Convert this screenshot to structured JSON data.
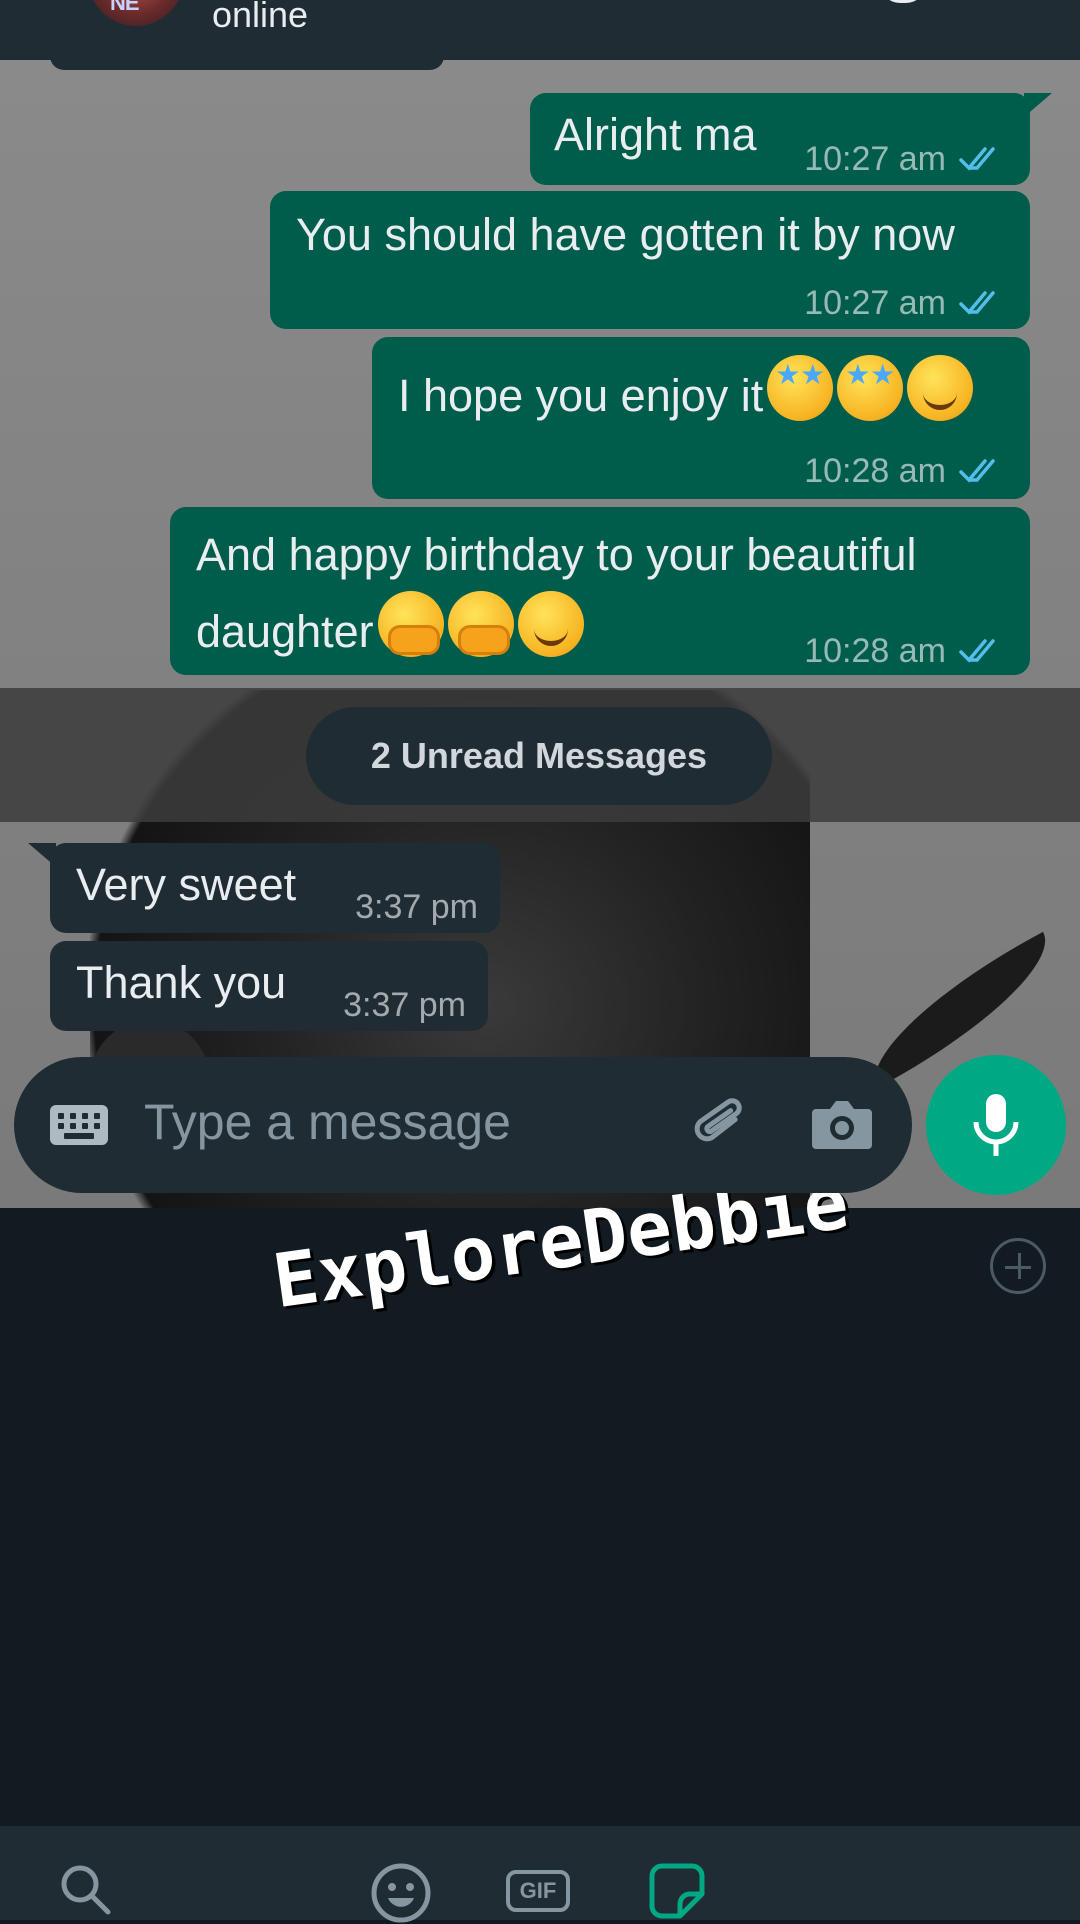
{
  "header": {
    "status": "online",
    "avatar_initials": "NE"
  },
  "messages": [
    {
      "direction": "outgoing",
      "text": "Alright ma",
      "time": "10:27 am",
      "status": "read"
    },
    {
      "direction": "outgoing",
      "text": "You should have gotten it by now",
      "time": "10:27 am",
      "status": "read"
    },
    {
      "direction": "outgoing",
      "text": "I hope you enjoy it",
      "emojis": [
        "star-struck-emoji",
        "star-struck-emoji",
        "smiling-face-emoji"
      ],
      "time": "10:28 am",
      "status": "read"
    },
    {
      "direction": "outgoing",
      "text_line1": "And happy birthday to your beautiful",
      "text_line2": "daughter",
      "emojis": [
        "hugging-face-emoji",
        "hugging-face-emoji",
        "smiling-face-emoji"
      ],
      "time": "10:28 am",
      "status": "read"
    },
    {
      "direction": "incoming",
      "text": "Very sweet",
      "time": "3:37 pm"
    },
    {
      "direction": "incoming",
      "text": "Thank you",
      "time": "3:37 pm"
    }
  ],
  "unread_banner": "2 Unread Messages",
  "composer": {
    "placeholder": "Type a message"
  },
  "watermark": "ExploreDebbie",
  "bottom_bar": {
    "gif_label": "GIF"
  },
  "colors": {
    "outgoing_bubble": "#005c4b",
    "incoming_bubble": "#202c33",
    "read_ticks": "#53bdeb",
    "accent": "#00a884",
    "panel_bg": "#121b22"
  }
}
